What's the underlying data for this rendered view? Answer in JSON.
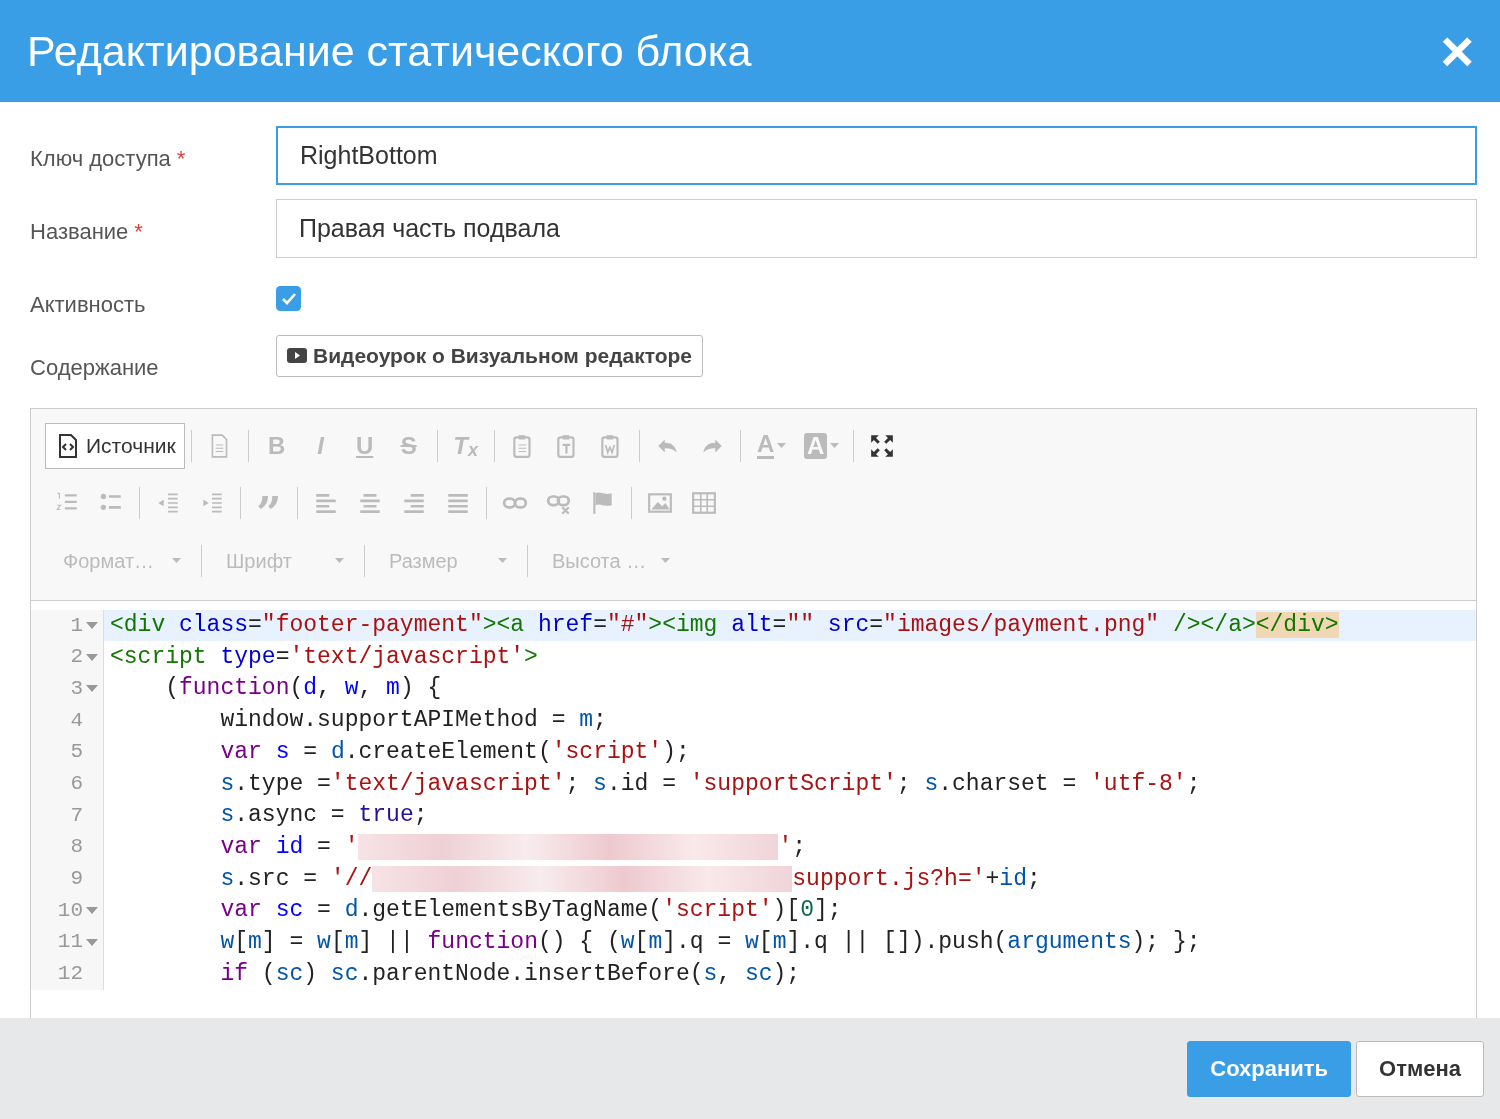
{
  "dialog": {
    "title": "Редактирование статического блока",
    "close": "×"
  },
  "fields": [
    {
      "kind": "text",
      "label": "Ключ доступа",
      "mark": "*",
      "value": "RightBottom",
      "focused": true
    },
    {
      "kind": "text",
      "label": "Название",
      "mark": "*",
      "value": "Правая часть подвала",
      "focused": false
    },
    {
      "kind": "checkbox",
      "label": "Активность",
      "checked": true
    },
    {
      "kind": "video",
      "label": "Содержание",
      "button": "Видеоурок о Визуальном редакторе"
    }
  ],
  "editor": {
    "toolbar_rows": [
      [
        [
          {
            "kind": "source",
            "label": "Источник",
            "disabled": false
          }
        ],
        [
          {
            "kind": "newpage",
            "disabled": true
          }
        ],
        [
          {
            "kind": "bold",
            "label": "B",
            "disabled": true
          },
          {
            "kind": "italic",
            "label": "I",
            "disabled": true
          },
          {
            "kind": "underline",
            "label": "U",
            "disabled": true
          },
          {
            "kind": "strike",
            "label": "S",
            "disabled": true
          }
        ],
        [
          {
            "kind": "clear",
            "label": "T$_{x}$",
            "disabled": true
          }
        ],
        [
          {
            "kind": "paste",
            "disabled": true
          },
          {
            "kind": "pastetext",
            "disabled": true
          },
          {
            "kind": "pasteword",
            "disabled": true
          }
        ],
        [
          {
            "kind": "undo",
            "disabled": true
          },
          {
            "kind": "redo",
            "disabled": true
          }
        ],
        [
          {
            "kind": "textcolor",
            "label": "A",
            "disabled": true
          },
          {
            "kind": "bgcolor",
            "label": "A",
            "disabled": true
          }
        ],
        [
          {
            "kind": "maximize",
            "disabled": false
          }
        ]
      ],
      [
        [
          {
            "kind": "numlist",
            "disabled": true
          },
          {
            "kind": "bullist",
            "disabled": true
          }
        ],
        [
          {
            "kind": "outdent",
            "disabled": true
          },
          {
            "kind": "indent",
            "disabled": true
          }
        ],
        [
          {
            "kind": "quote",
            "label": "”",
            "disabled": true
          }
        ],
        [
          {
            "kind": "alignleft",
            "disabled": true
          },
          {
            "kind": "aligncenter",
            "disabled": true
          },
          {
            "kind": "alignright",
            "disabled": true
          },
          {
            "kind": "justify",
            "disabled": true
          }
        ],
        [
          {
            "kind": "link",
            "disabled": true
          },
          {
            "kind": "unlink",
            "disabled": true
          },
          {
            "kind": "flag",
            "disabled": true
          }
        ],
        [
          {
            "kind": "image",
            "disabled": true
          },
          {
            "kind": "table",
            "disabled": true
          }
        ]
      ]
    ],
    "dropdowns": [
      {
        "label": "Формат…",
        "disabled": true
      },
      {
        "label": "Шрифт",
        "disabled": true
      },
      {
        "label": "Размер",
        "disabled": true
      },
      {
        "label": "Высота …",
        "disabled": true
      }
    ],
    "lines": [
      {
        "number": "1",
        "foldable": true,
        "active": true,
        "tokens": [
          {
            "kind": "tag",
            "text": "<div "
          },
          {
            "kind": "attr",
            "text": "class"
          },
          {
            "kind": "plain",
            "text": "="
          },
          {
            "kind": "string",
            "text": "\"footer-payment\""
          },
          {
            "kind": "tag",
            "text": "><a "
          },
          {
            "kind": "attr",
            "text": "href"
          },
          {
            "kind": "plain",
            "text": "="
          },
          {
            "kind": "string",
            "text": "\"#\""
          },
          {
            "kind": "tag",
            "text": "><img "
          },
          {
            "kind": "attr",
            "text": "alt"
          },
          {
            "kind": "plain",
            "text": "="
          },
          {
            "kind": "string",
            "text": "\"\" "
          },
          {
            "kind": "attr",
            "text": "src"
          },
          {
            "kind": "plain",
            "text": "="
          },
          {
            "kind": "string",
            "text": "\"images/payment.png\""
          },
          {
            "kind": "tag",
            "text": " /></a>"
          },
          {
            "kind": "match",
            "text": "</div>"
          }
        ]
      },
      {
        "number": "2",
        "foldable": true,
        "active": false,
        "tokens": [
          {
            "kind": "tag",
            "text": "<script "
          },
          {
            "kind": "attr",
            "text": "type"
          },
          {
            "kind": "plain",
            "text": "="
          },
          {
            "kind": "string",
            "text": "'text/javascript'"
          },
          {
            "kind": "tag",
            "text": ">"
          }
        ]
      },
      {
        "number": "3",
        "foldable": true,
        "active": false,
        "tokens": [
          {
            "kind": "plain",
            "text": "    ("
          },
          {
            "kind": "keyword",
            "text": "function"
          },
          {
            "kind": "plain",
            "text": "("
          },
          {
            "kind": "def",
            "text": "d"
          },
          {
            "kind": "plain",
            "text": ", "
          },
          {
            "kind": "def",
            "text": "w"
          },
          {
            "kind": "plain",
            "text": ", "
          },
          {
            "kind": "def",
            "text": "m"
          },
          {
            "kind": "plain",
            "text": ") {"
          }
        ]
      },
      {
        "number": "4",
        "foldable": false,
        "active": false,
        "tokens": [
          {
            "kind": "plain",
            "text": "        window.supportAPIMethod = "
          },
          {
            "kind": "var",
            "text": "m"
          },
          {
            "kind": "plain",
            "text": ";"
          }
        ]
      },
      {
        "number": "5",
        "foldable": false,
        "active": false,
        "tokens": [
          {
            "kind": "keyword",
            "text": "        var "
          },
          {
            "kind": "def",
            "text": "s"
          },
          {
            "kind": "plain",
            "text": " = "
          },
          {
            "kind": "var",
            "text": "d"
          },
          {
            "kind": "plain",
            "text": ".createElement("
          },
          {
            "kind": "string",
            "text": "'script'"
          },
          {
            "kind": "plain",
            "text": ");"
          }
        ]
      },
      {
        "number": "6",
        "foldable": false,
        "active": false,
        "tokens": [
          {
            "kind": "var",
            "text": "        s"
          },
          {
            "kind": "plain",
            "text": ".type ="
          },
          {
            "kind": "string",
            "text": "'text/javascript'"
          },
          {
            "kind": "plain",
            "text": "; "
          },
          {
            "kind": "var",
            "text": "s"
          },
          {
            "kind": "plain",
            "text": ".id = "
          },
          {
            "kind": "string",
            "text": "'supportScript'"
          },
          {
            "kind": "plain",
            "text": "; "
          },
          {
            "kind": "var",
            "text": "s"
          },
          {
            "kind": "plain",
            "text": ".charset = "
          },
          {
            "kind": "string",
            "text": "'utf-8'"
          },
          {
            "kind": "plain",
            "text": ";"
          }
        ]
      },
      {
        "number": "7",
        "foldable": false,
        "active": false,
        "tokens": [
          {
            "kind": "var",
            "text": "        s"
          },
          {
            "kind": "plain",
            "text": ".async = "
          },
          {
            "kind": "atom",
            "text": "true"
          },
          {
            "kind": "plain",
            "text": ";"
          }
        ]
      },
      {
        "number": "8",
        "foldable": false,
        "active": false,
        "tokens": [
          {
            "kind": "keyword",
            "text": "        var "
          },
          {
            "kind": "def",
            "text": "id"
          },
          {
            "kind": "plain",
            "text": " = "
          },
          {
            "kind": "string",
            "text": "'"
          },
          {
            "kind": "redacted"
          },
          {
            "kind": "string",
            "text": "'"
          },
          {
            "kind": "plain",
            "text": ";"
          }
        ]
      },
      {
        "number": "9",
        "foldable": false,
        "active": false,
        "tokens": [
          {
            "kind": "var",
            "text": "        s"
          },
          {
            "kind": "plain",
            "text": ".src = "
          },
          {
            "kind": "string",
            "text": "'//"
          },
          {
            "kind": "redacted"
          },
          {
            "kind": "string",
            "text": "support.js?h='"
          },
          {
            "kind": "plain",
            "text": "+"
          },
          {
            "kind": "var",
            "text": "id"
          },
          {
            "kind": "plain",
            "text": ";"
          }
        ]
      },
      {
        "number": "10",
        "foldable": true,
        "active": false,
        "tokens": [
          {
            "kind": "keyword",
            "text": "        var "
          },
          {
            "kind": "def",
            "text": "sc"
          },
          {
            "kind": "plain",
            "text": " = "
          },
          {
            "kind": "var",
            "text": "d"
          },
          {
            "kind": "plain",
            "text": ".getElementsByTagName("
          },
          {
            "kind": "string",
            "text": "'script'"
          },
          {
            "kind": "plain",
            "text": ")["
          },
          {
            "kind": "number",
            "text": "0"
          },
          {
            "kind": "plain",
            "text": "];"
          }
        ]
      },
      {
        "number": "11",
        "foldable": true,
        "active": false,
        "tokens": [
          {
            "kind": "var",
            "text": "        w"
          },
          {
            "kind": "plain",
            "text": "["
          },
          {
            "kind": "var",
            "text": "m"
          },
          {
            "kind": "plain",
            "text": "] = "
          },
          {
            "kind": "var",
            "text": "w"
          },
          {
            "kind": "plain",
            "text": "["
          },
          {
            "kind": "var",
            "text": "m"
          },
          {
            "kind": "plain",
            "text": "] || "
          },
          {
            "kind": "keyword",
            "text": "function"
          },
          {
            "kind": "plain",
            "text": "() { ("
          },
          {
            "kind": "var",
            "text": "w"
          },
          {
            "kind": "plain",
            "text": "["
          },
          {
            "kind": "var",
            "text": "m"
          },
          {
            "kind": "plain",
            "text": "].q = "
          },
          {
            "kind": "var",
            "text": "w"
          },
          {
            "kind": "plain",
            "text": "["
          },
          {
            "kind": "var",
            "text": "m"
          },
          {
            "kind": "plain",
            "text": "].q || []).push("
          },
          {
            "kind": "var",
            "text": "arguments"
          },
          {
            "kind": "plain",
            "text": "); };"
          }
        ]
      },
      {
        "number": "12",
        "foldable": false,
        "active": false,
        "tokens": [
          {
            "kind": "keyword",
            "text": "        if"
          },
          {
            "kind": "plain",
            "text": " ("
          },
          {
            "kind": "var",
            "text": "sc"
          },
          {
            "kind": "plain",
            "text": ") "
          },
          {
            "kind": "var",
            "text": "sc"
          },
          {
            "kind": "plain",
            "text": ".parentNode.insertBefore("
          },
          {
            "kind": "var",
            "text": "s"
          },
          {
            "kind": "plain",
            "text": ", "
          },
          {
            "kind": "var",
            "text": "sc"
          },
          {
            "kind": "plain",
            "text": ");"
          }
        ]
      }
    ]
  },
  "buttons": [
    {
      "kind": "primary",
      "label": "Сохранить"
    },
    {
      "kind": "secondary",
      "label": "Отмена"
    }
  ]
}
